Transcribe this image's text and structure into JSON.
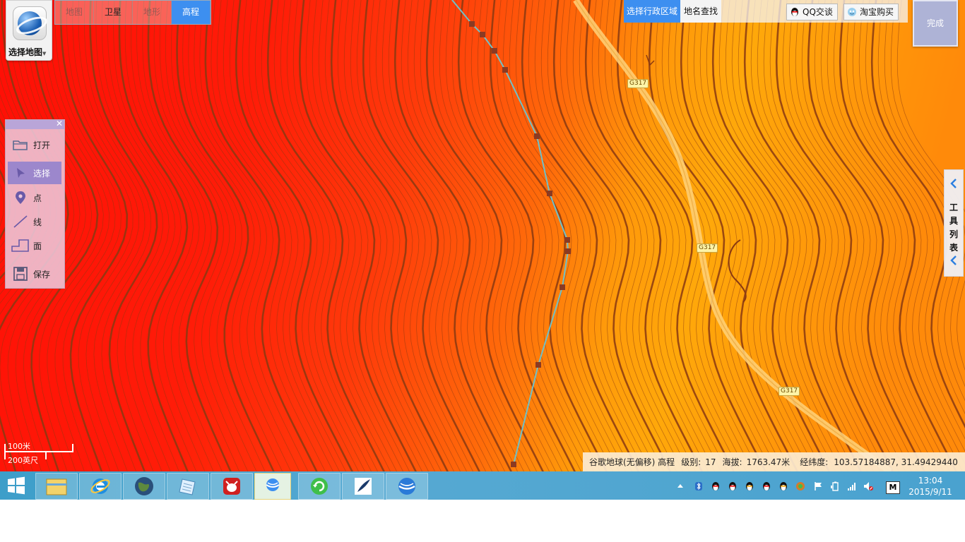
{
  "app": {
    "select_map_label": "选择地图",
    "map_tabs": [
      "地图",
      "卫星",
      "地形",
      "高程"
    ],
    "active_tab": "高程"
  },
  "search": {
    "region_label": "选择行政区域",
    "place_label": "地名查找",
    "qq_label": "QQ交谈",
    "taobao_label": "淘宝购买",
    "done_label": "完成"
  },
  "tools": {
    "items": [
      {
        "label": "打开",
        "icon": "folder-icon"
      },
      {
        "label": "选择",
        "icon": "cursor-icon"
      },
      {
        "label": "点",
        "icon": "pin-icon"
      },
      {
        "label": "线",
        "icon": "line-icon"
      },
      {
        "label": "面",
        "icon": "polygon-icon"
      },
      {
        "label": "保存",
        "icon": "save-icon"
      }
    ],
    "active": "选择"
  },
  "side_tab": {
    "label": "工具列表"
  },
  "map": {
    "road_labels": [
      "G317",
      "G317",
      "G317"
    ],
    "colors": {
      "low": "#ff1a0a",
      "high": "#ffa20a",
      "contour": "#8a3a12",
      "route": "#6fc0c8"
    }
  },
  "scale": {
    "metric": "100米",
    "imperial": "200英尺"
  },
  "status": {
    "source": "谷歌地球(无偏移) 高程",
    "level_label": "级别:",
    "level_value": "17",
    "altitude_label": "海拔:",
    "altitude_value": "1763.47米",
    "coord_label": "经纬度:",
    "coord_value": "103.57184887, 31.49429440"
  },
  "taskbar": {
    "time": "13:04",
    "date": "2015/9/11",
    "ime": "M"
  }
}
